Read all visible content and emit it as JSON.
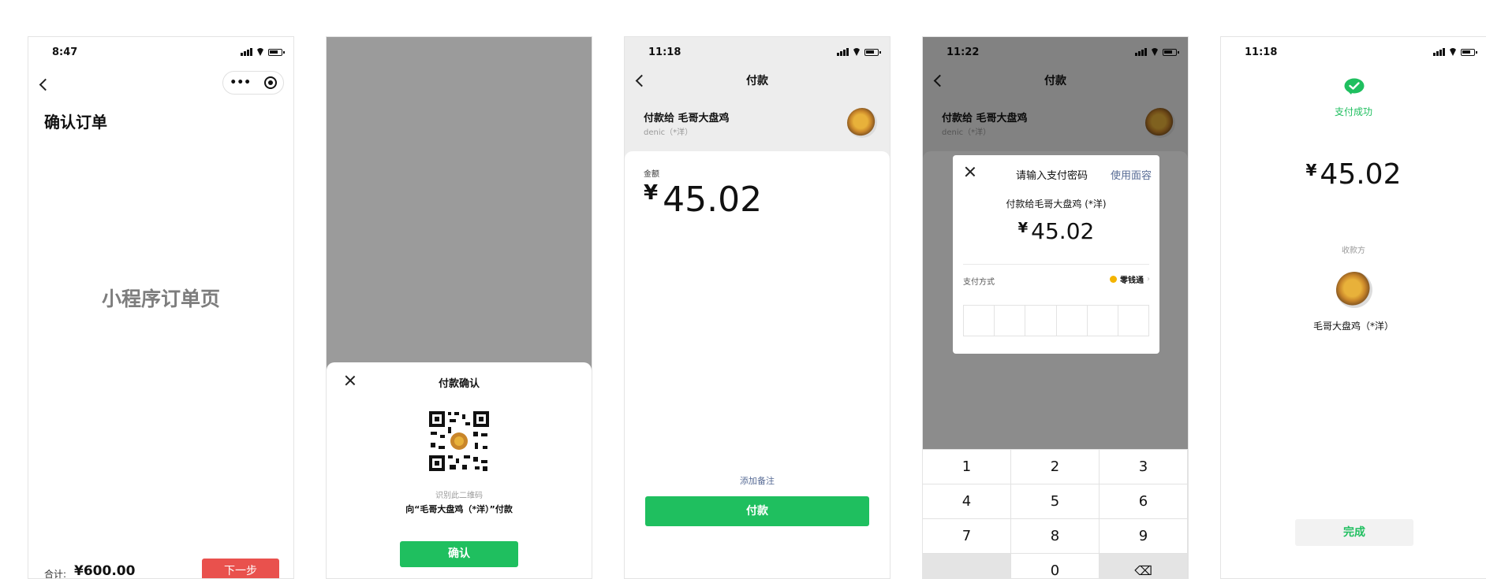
{
  "screen1": {
    "time": "8:47",
    "title": "确认订单",
    "placeholder": "小程序订单页",
    "total_label": "合计:",
    "total_value": "¥600.00",
    "next_button": "下一步"
  },
  "screen2": {
    "title": "付款确认",
    "qr_hint": "识别此二维码",
    "qr_target": "向“毛哥大盘鸡（*洋）”付款",
    "confirm_button": "确认"
  },
  "screen3": {
    "time": "11:18",
    "title": "付款",
    "payee_line": "付款给 毛哥大盘鸡",
    "payee_sub": "denic（*洋）",
    "amount_label": "金额",
    "currency": "¥",
    "amount": "45.02",
    "add_note": "添加备注",
    "pay_button": "付款"
  },
  "screen4": {
    "time": "11:22",
    "title": "付款",
    "payee_line": "付款给 毛哥大盘鸡",
    "payee_sub": "denic（*洋）",
    "dialog_title": "请输入支付密码",
    "face_pay": "使用面容",
    "dialog_payee": "付款给毛哥大盘鸡 (*洋)",
    "currency": "¥",
    "amount": "45.02",
    "pay_method_label": "支付方式",
    "pay_method_value": "零钱通",
    "keys": [
      "1",
      "2",
      "3",
      "4",
      "5",
      "6",
      "7",
      "8",
      "9",
      "",
      "0",
      "⌫"
    ]
  },
  "screen5": {
    "time": "11:18",
    "success": "支付成功",
    "currency": "¥",
    "amount": "45.02",
    "payee_label": "收款方",
    "payee_name": "毛哥大盘鸡（*洋）",
    "done_button": "完成"
  },
  "colors": {
    "green": "#1fbf5f",
    "red": "#e9514d",
    "link": "#576b95",
    "overlay": "#9b9b9b"
  }
}
